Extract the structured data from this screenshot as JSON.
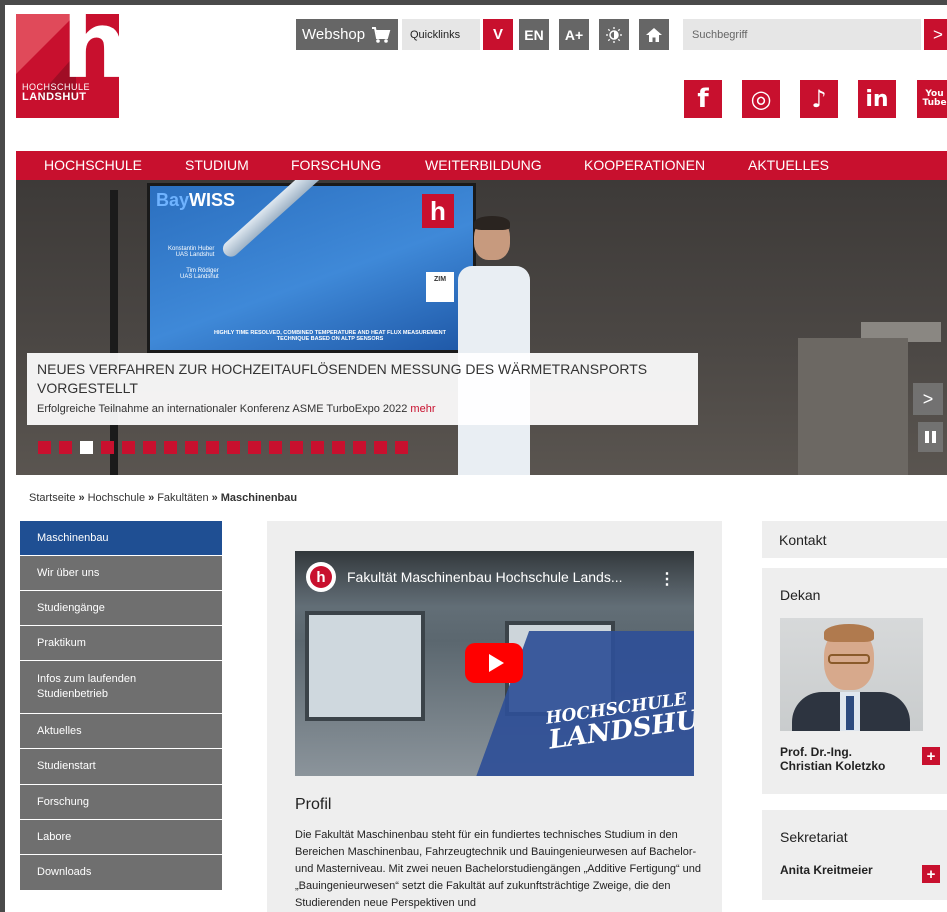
{
  "logo": {
    "line1": "HOCHSCHULE",
    "line2": "LANDSHUT",
    "letter": "h"
  },
  "topbar": {
    "webshop": "Webshop",
    "quicklinks": "Quicklinks",
    "quicklinks_toggle": "V",
    "lang": "EN",
    "font_size": "A+",
    "search_placeholder": "Suchbegriff",
    "search_go": ">"
  },
  "social": [
    {
      "name": "facebook",
      "glyph": "f"
    },
    {
      "name": "instagram",
      "glyph": "◎"
    },
    {
      "name": "tiktok",
      "glyph": "♪"
    },
    {
      "name": "linkedin",
      "glyph": "in"
    },
    {
      "name": "youtube",
      "glyph": "You Tube"
    }
  ],
  "nav": [
    "HOCHSCHULE",
    "STUDIUM",
    "FORSCHUNG",
    "WEITERBILDUNG",
    "KOOPERATIONEN",
    "AKTUELLES"
  ],
  "hero": {
    "screen_brand_a": "Bay",
    "screen_brand_b": "WISS",
    "screen_name1": "Konstantin Huber",
    "screen_aff1": "UAS Landshut",
    "screen_name2": "Tim Rödiger",
    "screen_aff2": "UAS Landshut",
    "screen_caption": "HIGHLY TIME RESOLVED, COMBINED TEMPERATURE AND HEAT FLUX MEASUREMENT TECHNIQUE BASED ON ALTP SENSORS",
    "screen_zim": "ZIM",
    "title": "Neues Verfahren zur hochzeitauflösenden Messung des Wärmetransports vorgestellt",
    "subtitle": "Erfolgreiche Teilnahme an internationaler Konferenz ASME TurboExpo 2022",
    "more": "mehr",
    "next": ">",
    "slide_count": 18,
    "active_slide": 3
  },
  "breadcrumb": {
    "items": [
      "Startseite",
      "Hochschule",
      "Fakultäten"
    ],
    "current": "Maschinenbau",
    "separator": "»"
  },
  "sidebar": [
    {
      "label": "Maschinenbau",
      "active": true
    },
    {
      "label": "Wir über uns"
    },
    {
      "label": "Studiengänge"
    },
    {
      "label": "Praktikum"
    },
    {
      "label": "Infos zum laufenden Studienbetrieb"
    },
    {
      "label": "Aktuelles"
    },
    {
      "label": "Studienstart"
    },
    {
      "label": "Forschung"
    },
    {
      "label": "Labore"
    },
    {
      "label": "Downloads"
    }
  ],
  "video": {
    "title": "Fakultät Maschinenbau Hochschule Lands...",
    "brand_line1": "HOCHSCHULE",
    "brand_line2": "LANDSHUT",
    "channel_letter": "h",
    "menu": "⋮"
  },
  "profil": {
    "heading": "Profil",
    "text": "Die Fakultät Maschinenbau steht für ein fundiertes technisches Studium in den Bereichen Maschinenbau, Fahrzeugtechnik und Bauingenieurwesen auf Bachelor- und Masterniveau. Mit zwei neuen Bachelorstudiengängen „Additive Fertigung“ und „Bauingenieurwesen“ setzt die Fakultät auf zukunftsträchtige Zweige, die den Studierenden neue Perspektiven und"
  },
  "contact": {
    "heading": "Kontakt",
    "dean_heading": "Dekan",
    "dean_name_1": "Prof. Dr.-Ing.",
    "dean_name_2": "Christian Koletzko",
    "secretariat_heading": "Sekretariat",
    "secretariat_name": "Anita Kreitmeier",
    "plus": "+"
  },
  "colors": {
    "brand_red": "#c8102e",
    "nav_active_blue": "#1f4f93",
    "sidebar_gray": "#6f6f6f"
  }
}
